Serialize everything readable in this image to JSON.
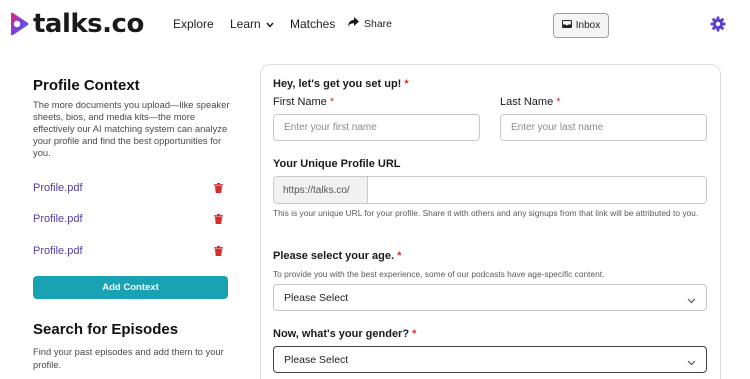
{
  "header": {
    "logo_text": "talks.co",
    "nav": {
      "explore": "Explore",
      "learn": "Learn",
      "matches": "Matches",
      "share": "Share"
    },
    "inbox_label": "Inbox",
    "icons": {
      "logo": "talks-play-logo-icon",
      "learn_chevron": "chevron-down-icon",
      "share": "share-arrow-icon",
      "inbox": "inbox-icon",
      "settings": "gear-icon"
    },
    "colors": {
      "gear": "#5b3fd1"
    }
  },
  "sidebar": {
    "profile_title": "Profile Context",
    "profile_description": "The more documents you upload—like speaker sheets, bios, and media kits—the more effectively our AI matching system can analyze your profile and find the best opportunities for you.",
    "files": [
      {
        "name": "Profile.pdf"
      },
      {
        "name": "Profile.pdf"
      },
      {
        "name": "Profile.pdf"
      }
    ],
    "add_context_label": "Add Context",
    "search_title": "Search for Episodes",
    "search_description": "Find your past episodes and add them to your profile.",
    "colors": {
      "file_link": "#4b3fa8",
      "trash": "#d32f2f",
      "add_button": "#18a2b3"
    }
  },
  "form": {
    "intro": "Hey, let's get you set up!",
    "required_mark": "*",
    "first_name": {
      "label": "First Name",
      "placeholder": "Enter your first name",
      "value": ""
    },
    "last_name": {
      "label": "Last Name",
      "placeholder": "Enter your last name",
      "value": ""
    },
    "profile_url": {
      "label": "Your Unique Profile URL",
      "prefix": "https://talks.co/",
      "value": "",
      "help": "This is your unique URL for your profile. Share it with others and any signups from that link will be attributed to you."
    },
    "age": {
      "label": "Please select your age.",
      "help": "To provide you with the best experience, some of our podcasts have age-specific content.",
      "selected": "Please Select"
    },
    "gender": {
      "label": "Now, what's your gender?",
      "selected": "Please Select"
    }
  }
}
